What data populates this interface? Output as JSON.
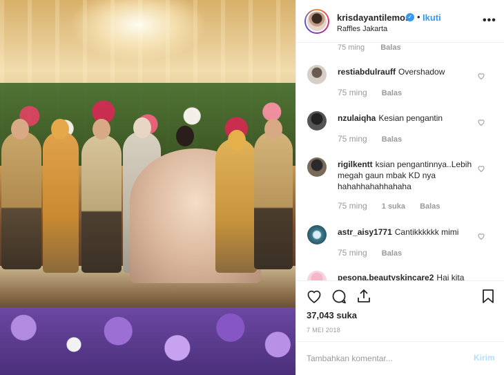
{
  "post": {
    "username": "krisdayantilemos",
    "separator": "•",
    "follow_label": "Ikuti",
    "location": "Raffles Jakarta",
    "more_icon": "more-horizontal-icon"
  },
  "comments": {
    "top_partial": {
      "time": "75 ming",
      "reply": "Balas"
    },
    "items": [
      {
        "username": "restiabdulrauff",
        "text": "Overshadow",
        "time": "75 ming",
        "reply": "Balas",
        "likes": ""
      },
      {
        "username": "nzulaiqha",
        "text": "Kesian pengantin",
        "time": "75 ming",
        "reply": "Balas",
        "likes": ""
      },
      {
        "username": "rigilkentt",
        "text": "ksian pengantinnya..Lebih megah gaun mbak KD nya hahahhahahhahaha",
        "time": "75 ming",
        "reply": "Balas",
        "likes": "1 suka"
      },
      {
        "username": "astr_aisy1771",
        "text": "Cantikkkkkk mimi",
        "time": "75 ming",
        "reply": "Balas",
        "likes": ""
      },
      {
        "username": "pesona.beautyskincare2",
        "text": "Hai kita",
        "time": "",
        "reply": "",
        "likes": ""
      }
    ]
  },
  "actions": {
    "like_icon": "heart-icon",
    "comment_icon": "comment-icon",
    "share_icon": "share-icon",
    "save_icon": "bookmark-icon",
    "likes_count": "37,043 suka",
    "date": "7 MEI 2018"
  },
  "composer": {
    "placeholder": "Tambahkan komentar...",
    "post_label": "Kirim"
  },
  "colors": {
    "accent": "#3897f0",
    "post_disabled": "#b2dffc",
    "muted": "#999999"
  }
}
